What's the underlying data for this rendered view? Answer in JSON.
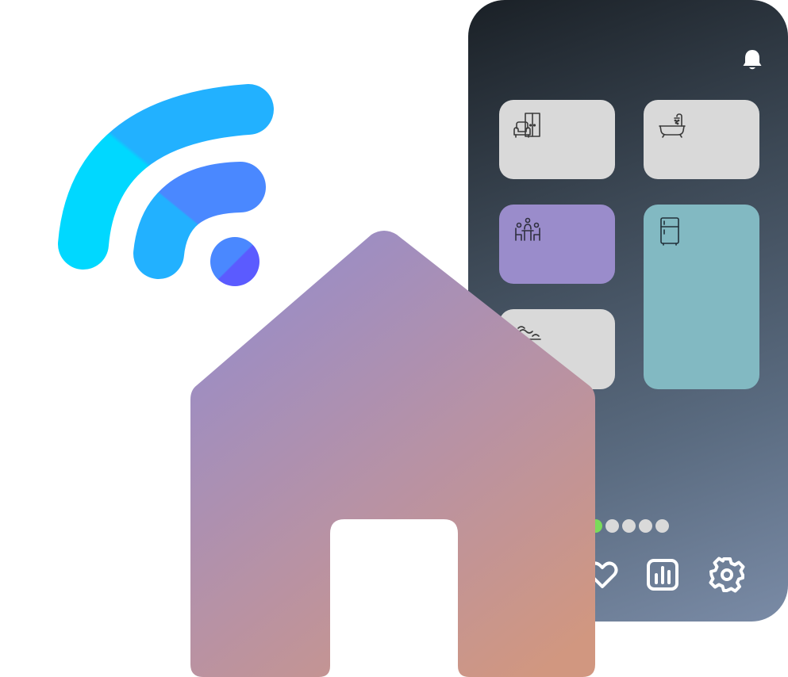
{
  "illustration": {
    "phone": {
      "background_top": "#1a2026",
      "background_bottom": "#7a8ba6",
      "header": {
        "icon": "bell-icon"
      },
      "rooms": [
        {
          "icon": "living-room-icon",
          "color": "#d9d9d9"
        },
        {
          "icon": "bathroom-icon",
          "color": "#d9d9d9"
        },
        {
          "icon": "dining-room-icon",
          "color": "#9a8ccb"
        },
        {
          "icon": "fridge-icon",
          "color": "#82b9c2"
        },
        {
          "icon": "kitchen-icon",
          "color": "#d9d9d9"
        }
      ],
      "pager": {
        "pages": 5,
        "active_page": 1,
        "active_color": "#7bdc5a"
      },
      "bottom_nav": [
        {
          "icon": "heart-icon"
        },
        {
          "icon": "stats-icon"
        },
        {
          "icon": "settings-icon"
        }
      ]
    },
    "wifi": {
      "icon": "wifi-icon",
      "colors": [
        "#00d8ff",
        "#22b1ff",
        "#4a88ff",
        "#5b5bff"
      ]
    },
    "house": {
      "icon": "house-icon",
      "gradient_start": "#958ccc",
      "gradient_end": "#d19780"
    }
  }
}
